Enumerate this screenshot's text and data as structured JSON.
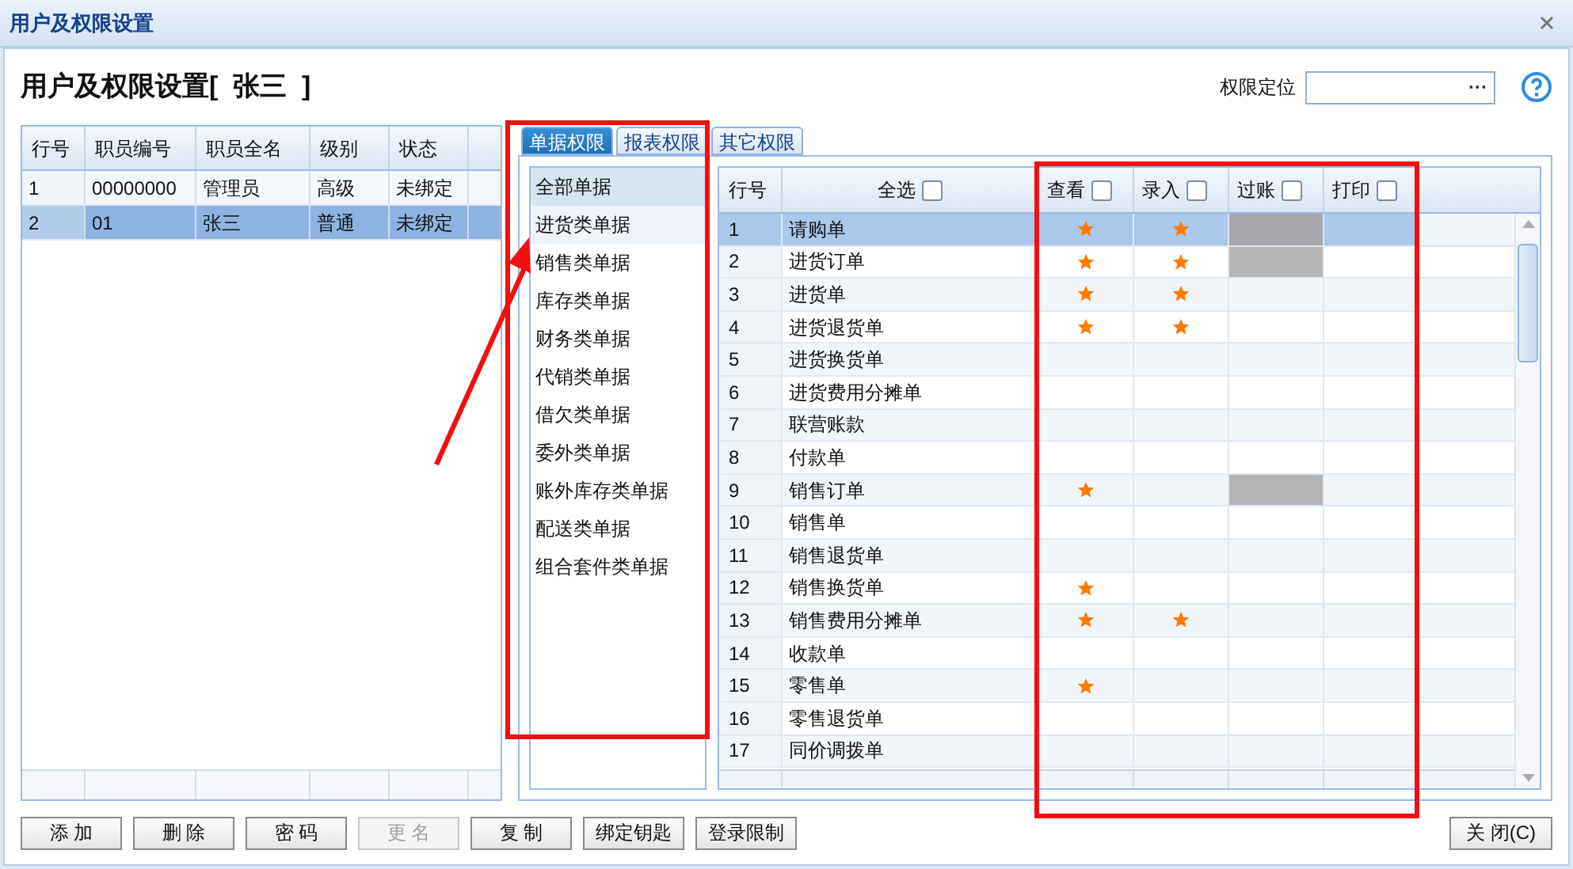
{
  "window": {
    "title": "用户及权限设置"
  },
  "heading": "用户及权限设置[  张三  ]",
  "locate": {
    "label": "权限定位",
    "button": "···"
  },
  "users": {
    "columns": [
      "行号",
      "职员编号",
      "职员全名",
      "级别",
      "状态"
    ],
    "rows": [
      {
        "cells": [
          "1",
          "00000000",
          "管理员",
          "高级",
          "未绑定"
        ],
        "selected": false
      },
      {
        "cells": [
          "2",
          "01",
          "张三",
          "普通",
          "未绑定"
        ],
        "selected": true
      }
    ]
  },
  "tabs": [
    {
      "label": "单据权限",
      "selected": true
    },
    {
      "label": "报表权限",
      "selected": false
    },
    {
      "label": "其它权限",
      "selected": false
    }
  ],
  "categories": [
    {
      "label": "全部单据",
      "selected": true
    },
    {
      "label": "进货类单据",
      "selected": false
    },
    {
      "label": "销售类单据",
      "selected": false
    },
    {
      "label": "库存类单据",
      "selected": false
    },
    {
      "label": "财务类单据",
      "selected": false
    },
    {
      "label": "代销类单据",
      "selected": false
    },
    {
      "label": "借欠类单据",
      "selected": false
    },
    {
      "label": "委外类单据",
      "selected": false
    },
    {
      "label": "账外库存类单据",
      "selected": false
    },
    {
      "label": "配送类单据",
      "selected": false
    },
    {
      "label": "组合套件类单据",
      "selected": false
    }
  ],
  "permissions": {
    "columns": [
      {
        "label": "行号"
      },
      {
        "label": "全选",
        "checked": false
      },
      {
        "label": "查看",
        "checked": false
      },
      {
        "label": "录入",
        "checked": false
      },
      {
        "label": "过账",
        "checked": false
      },
      {
        "label": "打印",
        "checked": false
      }
    ],
    "rows": [
      {
        "no": "1",
        "name": "请购单",
        "selected": true,
        "view": true,
        "entry": true,
        "post_disabled": true
      },
      {
        "no": "2",
        "name": "进货订单",
        "selected": false,
        "view": true,
        "entry": true,
        "post_disabled": true
      },
      {
        "no": "3",
        "name": "进货单",
        "selected": false,
        "view": true,
        "entry": true,
        "post_disabled": false
      },
      {
        "no": "4",
        "name": "进货退货单",
        "selected": false,
        "view": true,
        "entry": true,
        "post_disabled": false
      },
      {
        "no": "5",
        "name": "进货换货单",
        "selected": false,
        "view": false,
        "entry": false,
        "post_disabled": false
      },
      {
        "no": "6",
        "name": "进货费用分摊单",
        "selected": false,
        "view": false,
        "entry": false,
        "post_disabled": false
      },
      {
        "no": "7",
        "name": "联营账款",
        "selected": false,
        "view": false,
        "entry": false,
        "post_disabled": false
      },
      {
        "no": "8",
        "name": "付款单",
        "selected": false,
        "view": false,
        "entry": false,
        "post_disabled": false
      },
      {
        "no": "9",
        "name": "销售订单",
        "selected": false,
        "view": true,
        "entry": false,
        "post_disabled": true
      },
      {
        "no": "10",
        "name": "销售单",
        "selected": false,
        "view": false,
        "entry": false,
        "post_disabled": false
      },
      {
        "no": "11",
        "name": "销售退货单",
        "selected": false,
        "view": false,
        "entry": false,
        "post_disabled": false
      },
      {
        "no": "12",
        "name": "销售换货单",
        "selected": false,
        "view": true,
        "entry": false,
        "post_disabled": false
      },
      {
        "no": "13",
        "name": "销售费用分摊单",
        "selected": false,
        "view": true,
        "entry": true,
        "post_disabled": false
      },
      {
        "no": "14",
        "name": "收款单",
        "selected": false,
        "view": false,
        "entry": false,
        "post_disabled": false
      },
      {
        "no": "15",
        "name": "零售单",
        "selected": false,
        "view": true,
        "entry": false,
        "post_disabled": false
      },
      {
        "no": "16",
        "name": "零售退货单",
        "selected": false,
        "view": false,
        "entry": false,
        "post_disabled": false
      },
      {
        "no": "17",
        "name": "同价调拨单",
        "selected": false,
        "view": false,
        "entry": false,
        "post_disabled": false
      }
    ]
  },
  "buttons": [
    {
      "label": "添 加",
      "disabled": false
    },
    {
      "label": "删 除",
      "disabled": false
    },
    {
      "label": "密 码",
      "disabled": false
    },
    {
      "label": "更 名",
      "disabled": true
    },
    {
      "label": "复 制",
      "disabled": false
    },
    {
      "label": "绑定钥匙",
      "disabled": false
    },
    {
      "label": "登录限制",
      "disabled": false
    }
  ],
  "close_button": "关 闭(C)"
}
